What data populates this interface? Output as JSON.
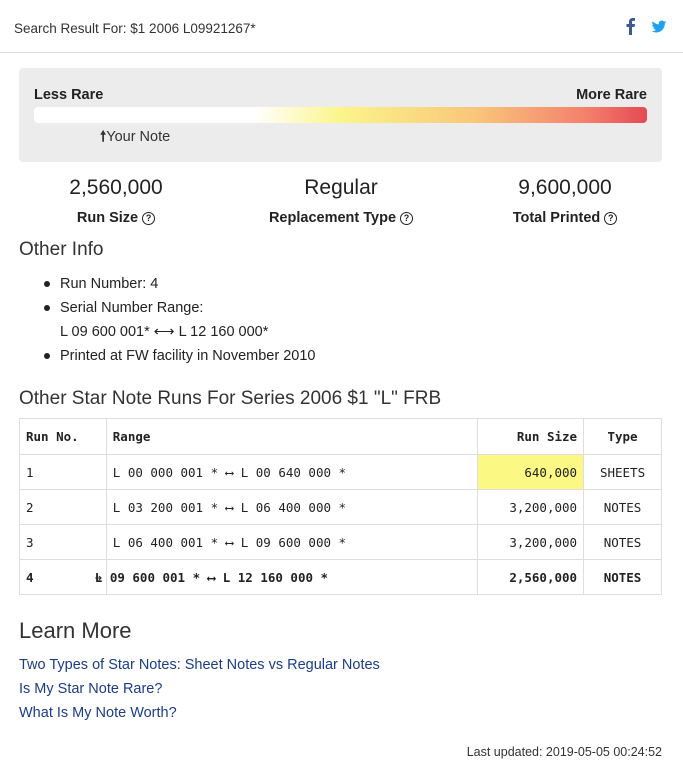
{
  "header": {
    "search_label": "Search Result For: $1 2006 L09921267*",
    "share_icons": [
      "facebook-icon",
      "twitter-icon"
    ]
  },
  "rarity": {
    "less_label": "Less Rare",
    "more_label": "More Rare",
    "your_note_arrow": "🠕",
    "your_note_label": "Your Note"
  },
  "stats": [
    {
      "value": "2,560,000",
      "label": "Run Size"
    },
    {
      "value": "Regular",
      "label": "Replacement Type"
    },
    {
      "value": "9,600,000",
      "label": "Total Printed"
    }
  ],
  "help_icon": "?",
  "other_info": {
    "heading": "Other Info",
    "run_number": "Run Number: 4",
    "serial_range_label": "Serial Number Range:",
    "serial_range_value": "L 09 600 001* ⟷ L 12 160 000*",
    "printed_at": "Printed at FW facility in November 2010"
  },
  "runs_table": {
    "heading": "Other Star Note Runs For Series 2006 $1 \"L\" FRB",
    "columns": [
      "Run No.",
      "Range",
      "Run Size",
      "Type"
    ],
    "rows": [
      {
        "run": "1",
        "range": "L 00 000 001 * ⟷ L 00 640 000 *",
        "size": "640,000",
        "type": "SHEETS"
      },
      {
        "run": "2",
        "range": "L 03 200 001 * ⟷ L 06 400 000 *",
        "size": "3,200,000",
        "type": "NOTES"
      },
      {
        "run": "3",
        "range": "L 06 400 001 * ⟷ L 09 600 000 *",
        "size": "3,200,000",
        "type": "NOTES"
      },
      {
        "run": "4",
        "range": "L 09 600 001 * ⟷ L 12 160 000 *",
        "size": "2,560,000",
        "type": "NOTES"
      }
    ],
    "current_arrow": "➔",
    "highlight_color": "#fbf883"
  },
  "learn_more": {
    "heading": "Learn More",
    "links": [
      "Two Types of Star Notes: Sheet Notes vs Regular Notes",
      "Is My Star Note Rare?",
      "What Is My Note Worth?"
    ]
  },
  "footer": {
    "last_updated": "Last updated: 2019-05-05 00:24:52"
  },
  "colors": {
    "link": "#1a3d8a",
    "facebook": "#3b5998",
    "twitter": "#1da1f2",
    "gradient_end": "#e44a52"
  }
}
